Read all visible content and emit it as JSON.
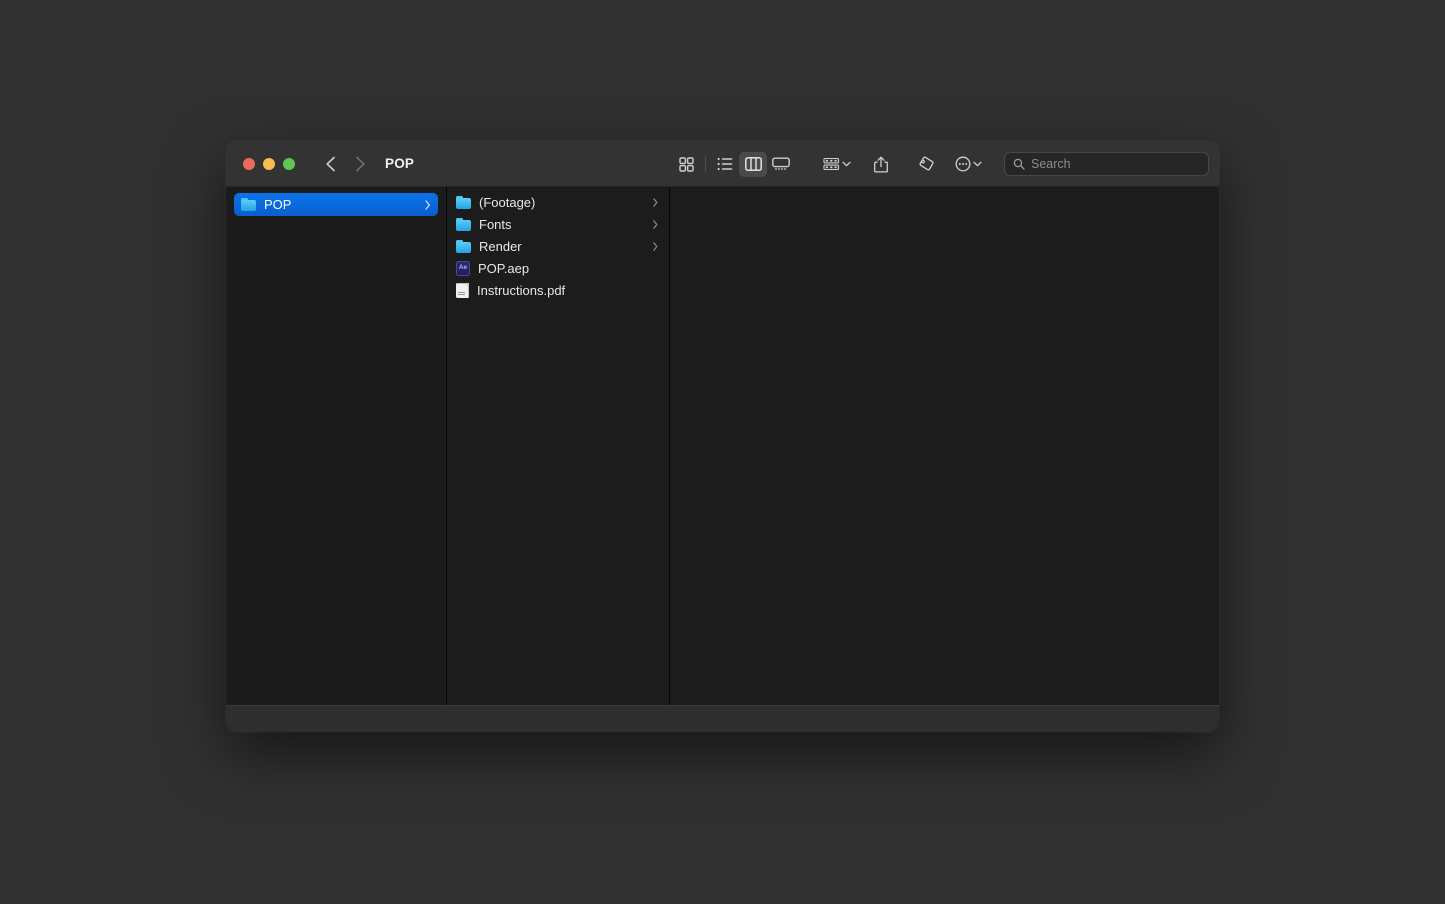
{
  "desktop": {
    "background": "#313131"
  },
  "window": {
    "title": "POP",
    "traffic_lights": [
      {
        "name": "close",
        "color": "#ED6A5E"
      },
      {
        "name": "minimize",
        "color": "#F5BF4F"
      },
      {
        "name": "maximize",
        "color": "#61C454"
      }
    ],
    "nav": {
      "back_label": "Back",
      "forward_label": "Forward"
    }
  },
  "toolbar": {
    "view_modes": [
      {
        "id": "icon",
        "label": "Icon View",
        "active": false
      },
      {
        "id": "list",
        "label": "List View",
        "active": false
      },
      {
        "id": "column",
        "label": "Column View",
        "active": true
      },
      {
        "id": "gallery",
        "label": "Gallery View",
        "active": false
      }
    ],
    "group_label": "Group",
    "share_label": "Share",
    "tags_label": "Tags",
    "more_label": "More"
  },
  "search": {
    "placeholder": "Search",
    "value": ""
  },
  "sidebar": {
    "items": [
      {
        "label": "POP",
        "icon": "folder-icon",
        "selected": true,
        "disclosure": true
      }
    ],
    "selection_color": "#0a74e8"
  },
  "columns": [
    {
      "items": [
        {
          "label": "(Footage)",
          "icon": "folder-icon",
          "kind": "folder",
          "disclosure": true
        },
        {
          "label": "Fonts",
          "icon": "folder-icon",
          "kind": "folder",
          "disclosure": true
        },
        {
          "label": "Render",
          "icon": "folder-icon",
          "kind": "folder",
          "disclosure": true
        },
        {
          "label": "POP.aep",
          "icon": "after-effects-icon",
          "kind": "file",
          "disclosure": false
        },
        {
          "label": "Instructions.pdf",
          "icon": "pdf-document-icon",
          "kind": "file",
          "disclosure": false
        }
      ]
    },
    {
      "items": []
    }
  ],
  "statusbar": {
    "text": ""
  }
}
